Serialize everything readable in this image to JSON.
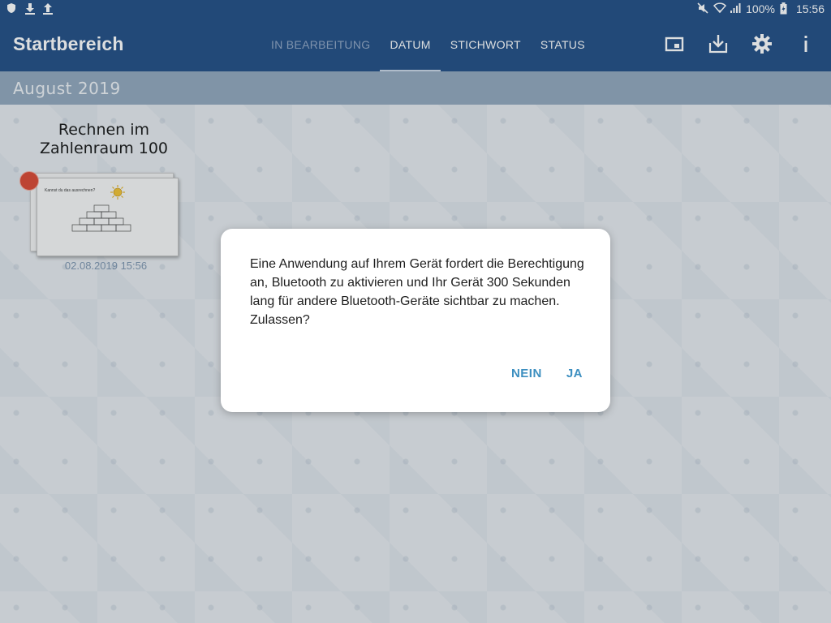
{
  "status_bar": {
    "battery": "100%",
    "time": "15:56",
    "left_icons": [
      "shield-icon",
      "download-icon",
      "upload-icon"
    ],
    "right_icons": [
      "mute-icon",
      "wifi-icon",
      "signal-icon",
      "battery-icon"
    ]
  },
  "app_bar": {
    "title": "Startbereich",
    "tabs": [
      {
        "label": "IN BEARBEITUNG",
        "active": false
      },
      {
        "label": "DATUM",
        "active": true
      },
      {
        "label": "STICHWORT",
        "active": false
      },
      {
        "label": "STATUS",
        "active": false
      }
    ],
    "actions": [
      "cast-icon",
      "download-box-icon",
      "gear-icon",
      "info-icon"
    ]
  },
  "month_header": "August 2019",
  "items": [
    {
      "title": "Rechnen im Zahlenraum 100",
      "date": "02.08.2019 15:56",
      "thumbnail_caption": "Kannst du das ausrechnen?"
    }
  ],
  "dialog": {
    "message": "Eine Anwendung auf Ihrem Gerät fordert die Berechtigung an, Bluetooth zu aktivieren und Ihr Gerät 300 Sekunden lang für andere Bluetooth-Geräte sichtbar zu machen. Zulassen?",
    "negative": "NEIN",
    "positive": "JA"
  },
  "colors": {
    "primary": "#1d4a82",
    "month_bar": "#8fa5bb",
    "accent_button": "#3d8fc0",
    "indicator_dot": "#d9442e"
  }
}
